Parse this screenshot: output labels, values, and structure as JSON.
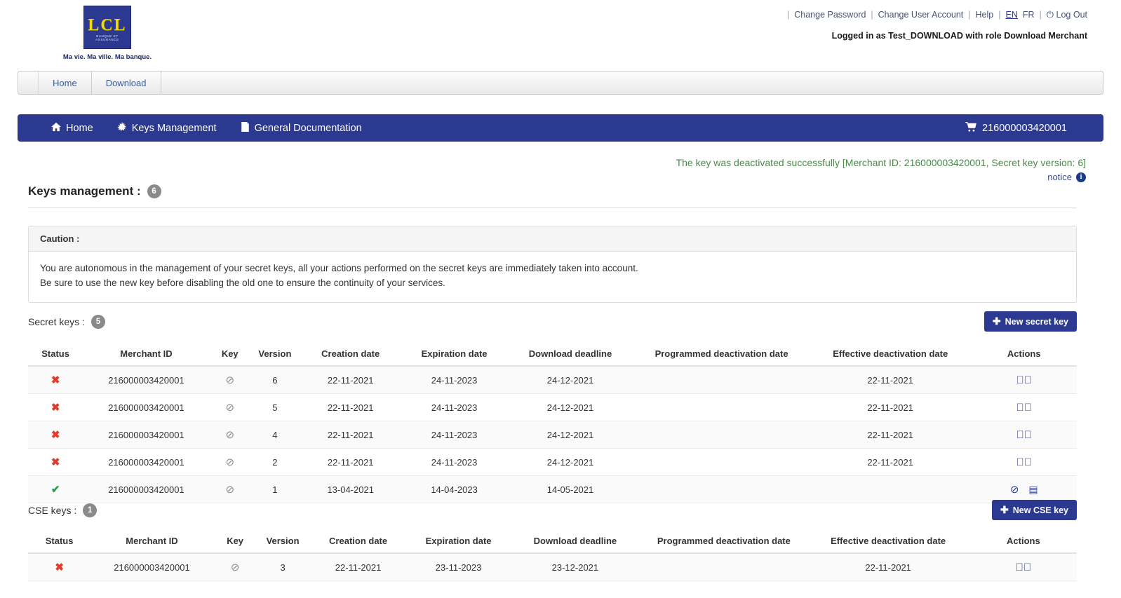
{
  "header": {
    "logo": {
      "mark_text": "LCL",
      "mark_sub": "BANQUE ET ASSURANCE",
      "tagline": "Ma vie. Ma ville. Ma banque."
    },
    "links": [
      {
        "label": "Change Password",
        "name": "change-password-link"
      },
      {
        "label": "Change User Account",
        "name": "change-user-account-link"
      },
      {
        "label": "Help",
        "name": "help-link"
      }
    ],
    "languages": [
      {
        "label": "EN",
        "active": true
      },
      {
        "label": "FR",
        "active": false
      }
    ],
    "logout_label": "Log Out",
    "logged_in_text": "Logged in as Test_DOWNLOAD with role Download Merchant"
  },
  "tabs": [
    {
      "label": "Home"
    },
    {
      "label": "Download"
    }
  ],
  "nav": {
    "items": [
      {
        "label": "Home",
        "icon": "home-icon"
      },
      {
        "label": "Keys Management",
        "icon": "sparkle-icon"
      },
      {
        "label": "General Documentation",
        "icon": "book-icon"
      }
    ],
    "merchant_id": "216000003420001",
    "merchant_icon": "cart-icon",
    "bg_color": "#2b3990"
  },
  "notice": {
    "message": "The key was deactivated successfully [Merchant ID: 216000003420001, Secret key version: 6]",
    "message_color": "#4a8a4a",
    "link_label": "notice"
  },
  "page": {
    "title": "Keys management :",
    "title_count": "6"
  },
  "caution": {
    "heading": "Caution :",
    "line1": "You are autonomous in the management of your secret keys, all your actions performed on the secret keys are immediately taken into account.",
    "line2": "Be sure to use the new key before disabling the old one to ensure the continuity of your services."
  },
  "secret_keys": {
    "title": "Secret keys :",
    "count": "5",
    "new_button_label": "New secret key",
    "columns": [
      "Status",
      "Merchant ID",
      "Key",
      "Version",
      "Creation date",
      "Expiration date",
      "Download deadline",
      "Programmed deactivation date",
      "Effective deactivation date",
      "Actions"
    ],
    "rows": [
      {
        "status": "inactive",
        "merchant_id": "216000003420001",
        "key": "no-entry-icon",
        "version": "6",
        "creation_date": "22-11-2021",
        "expiration_date": "24-11-2023",
        "download_deadline": "24-12-2021",
        "programmed_deactivation_date": "",
        "effective_deactivation_date": "22-11-2021",
        "actions": [
          "activate-icon"
        ]
      },
      {
        "status": "inactive",
        "merchant_id": "216000003420001",
        "key": "no-entry-icon",
        "version": "5",
        "creation_date": "22-11-2021",
        "expiration_date": "24-11-2023",
        "download_deadline": "24-12-2021",
        "programmed_deactivation_date": "",
        "effective_deactivation_date": "22-11-2021",
        "actions": [
          "activate-icon"
        ]
      },
      {
        "status": "inactive",
        "merchant_id": "216000003420001",
        "key": "no-entry-icon",
        "version": "4",
        "creation_date": "22-11-2021",
        "expiration_date": "24-11-2023",
        "download_deadline": "24-12-2021",
        "programmed_deactivation_date": "",
        "effective_deactivation_date": "22-11-2021",
        "actions": [
          "activate-icon"
        ]
      },
      {
        "status": "inactive",
        "merchant_id": "216000003420001",
        "key": "no-entry-icon",
        "version": "2",
        "creation_date": "22-11-2021",
        "expiration_date": "24-11-2023",
        "download_deadline": "24-12-2021",
        "programmed_deactivation_date": "",
        "effective_deactivation_date": "22-11-2021",
        "actions": [
          "activate-icon"
        ]
      },
      {
        "status": "active",
        "merchant_id": "216000003420001",
        "key": "no-entry-icon",
        "version": "1",
        "creation_date": "13-04-2021",
        "expiration_date": "14-04-2023",
        "download_deadline": "14-05-2021",
        "programmed_deactivation_date": "",
        "effective_deactivation_date": "",
        "actions": [
          "deactivate-icon",
          "calendar-icon"
        ]
      }
    ]
  },
  "cse_keys": {
    "title": "CSE keys :",
    "count": "1",
    "new_button_label": "New CSE key",
    "columns": [
      "Status",
      "Merchant ID",
      "Key",
      "Version",
      "Creation date",
      "Expiration date",
      "Download deadline",
      "Programmed deactivation date",
      "Effective deactivation date",
      "Actions"
    ],
    "rows": [
      {
        "status": "inactive",
        "merchant_id": "216000003420001",
        "key": "no-entry-icon",
        "version": "3",
        "creation_date": "22-11-2021",
        "expiration_date": "23-11-2023",
        "download_deadline": "23-12-2021",
        "programmed_deactivation_date": "",
        "effective_deactivation_date": "22-11-2021",
        "actions": [
          "activate-icon"
        ]
      }
    ]
  },
  "glyphs": {
    "cross": "✖",
    "check": "✔",
    "no_entry": "⊘",
    "activate": "✔",
    "deactivate": "⊘",
    "calendar": "▤",
    "plus": "✚",
    "home": "⌂",
    "sparkle": "✻",
    "book": "◪",
    "cart": "Ὥ2",
    "power": "⏻",
    "info": "i"
  }
}
